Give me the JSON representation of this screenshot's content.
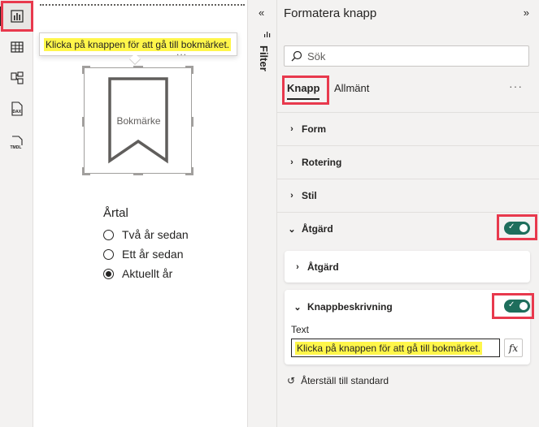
{
  "canvas": {
    "tooltip": "Klicka på knappen för att gå till bokmärket.",
    "more": "...",
    "visual_label": "Bokmärke",
    "slicer": {
      "title": "Årtal",
      "options": [
        {
          "label": "Två år sedan",
          "checked": false
        },
        {
          "label": "Ett år sedan",
          "checked": false
        },
        {
          "label": "Aktuellt år",
          "checked": true
        }
      ]
    }
  },
  "filter_strip": {
    "chevron": "«",
    "label": "Filter"
  },
  "pane": {
    "title": "Formatera knapp",
    "close_chevron": "»",
    "search_placeholder": "Sök",
    "tabs": [
      {
        "label": "Knapp"
      },
      {
        "label": "Allmänt"
      }
    ],
    "more": "···",
    "sections": [
      {
        "label": "Form"
      },
      {
        "label": "Rotering"
      },
      {
        "label": "Stil"
      },
      {
        "label": "Åtgärd"
      }
    ],
    "subsections": {
      "action_label": "Åtgärd",
      "tooltip_label": "Knappbeskrivning",
      "text_label": "Text",
      "text_value": "Klicka på knappen för att gå till bokmärket.",
      "fx": "fx"
    },
    "reset": "Återställ till standard"
  },
  "colors": {
    "highlight": "#e8394d",
    "toggle_on": "#1e6e5c",
    "marker_yellow": "#fff64a"
  }
}
